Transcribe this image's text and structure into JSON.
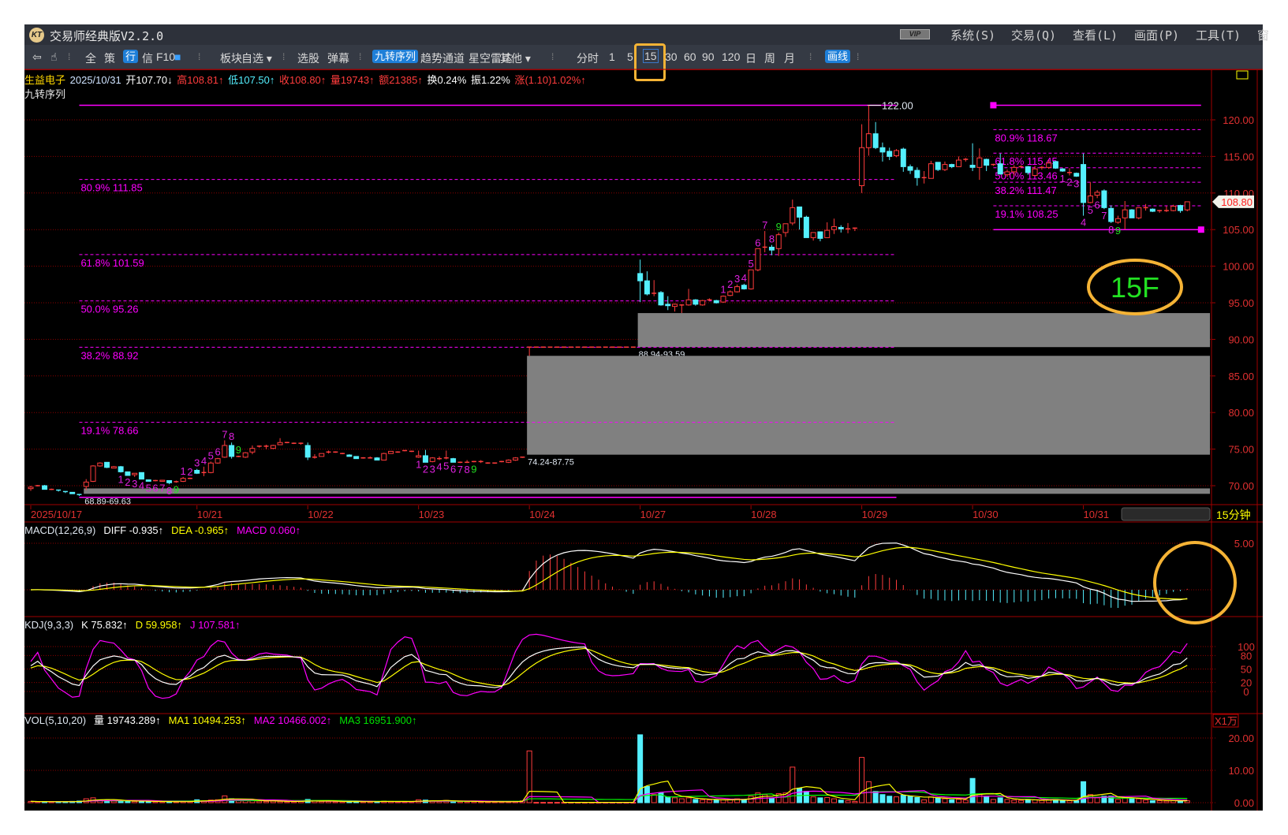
{
  "window": {
    "title": "交易师经典版V2.2.0",
    "logo_text": "KT",
    "vip": "VIP",
    "menu": [
      "系统(S)",
      "交易(Q)",
      "查看(L)",
      "画面(P)",
      "工具(T)",
      "窗"
    ]
  },
  "toolbar": {
    "items": [
      {
        "label": "⇦",
        "name": "back-icon"
      },
      {
        "label": "☝",
        "name": "hand-icon"
      },
      {
        "label": "⁞",
        "name": "separator"
      },
      {
        "label": "全",
        "name": "btn-all"
      },
      {
        "label": "策",
        "name": "btn-strategy"
      },
      {
        "label": "行",
        "name": "btn-quote",
        "style": "blue"
      },
      {
        "label": "信",
        "name": "btn-info"
      },
      {
        "label": "F10",
        "name": "btn-f10"
      },
      {
        "label": "■",
        "name": "color-icon"
      },
      {
        "label": "⁞",
        "name": "separator"
      },
      {
        "label": "板块",
        "name": "btn-sector"
      },
      {
        "label": "自选 ▾",
        "name": "btn-watchlist"
      },
      {
        "label": "⁞",
        "name": "separator"
      },
      {
        "label": "选股",
        "name": "btn-stock-picker"
      },
      {
        "label": "弹幕",
        "name": "btn-danmaku"
      },
      {
        "label": "⁞",
        "name": "separator"
      },
      {
        "label": "九转序列",
        "name": "btn-nine-turn",
        "style": "blue"
      },
      {
        "label": "趋势通道",
        "name": "btn-trend-channel"
      },
      {
        "label": "星空雷达",
        "name": "btn-star-radar"
      },
      {
        "label": "其他 ▾",
        "name": "btn-other"
      },
      {
        "label": "⁞",
        "name": "separator"
      },
      {
        "label": "分时",
        "name": "period-intraday"
      },
      {
        "label": "1",
        "name": "period-1"
      },
      {
        "label": "5",
        "name": "period-5"
      },
      {
        "label": "15",
        "name": "period-15",
        "style": "sel"
      },
      {
        "label": "30",
        "name": "period-30"
      },
      {
        "label": "60",
        "name": "period-60"
      },
      {
        "label": "90",
        "name": "period-90"
      },
      {
        "label": "120",
        "name": "period-120"
      },
      {
        "label": "日",
        "name": "period-day"
      },
      {
        "label": "周",
        "name": "period-week"
      },
      {
        "label": "月",
        "name": "period-month"
      },
      {
        "label": "⁞",
        "name": "separator"
      },
      {
        "label": "画线",
        "name": "btn-draw-line",
        "style": "blue"
      },
      {
        "label": "⁞",
        "name": "separator"
      }
    ]
  },
  "quote": {
    "name": "生益电子",
    "date": "2025/10/31",
    "open": "开107.70↓",
    "high": "高108.81↑",
    "low": "低107.50↑",
    "close": "收108.80↑",
    "volume": "量19743↑",
    "amount": "额21385↑",
    "turnover": "换0.24%",
    "amplitude": "振1.22%",
    "change": "涨(1.10)1.02%↑"
  },
  "indicator_title": "九转序列",
  "colors": {
    "up": "#ff3c3c",
    "down": "#54f0ff",
    "fib": "#ff00ff",
    "axis": "#e03030",
    "grid": "#8b0000",
    "annotation": "#f5b335",
    "green": "#22e022"
  },
  "price_axis": {
    "ticks": [
      "120.00",
      "115.00",
      "110.00",
      "105.00",
      "100.00",
      "95.00",
      "90.00",
      "85.00",
      "80.00",
      "75.00",
      "70.00"
    ],
    "last_price": "108.80"
  },
  "period_label": "15分钟",
  "dates": [
    {
      "i": 0,
      "label": "2025/10/17"
    },
    {
      "i": 24,
      "label": "10/21"
    },
    {
      "i": 40,
      "label": "10/22"
    },
    {
      "i": 56,
      "label": "10/23"
    },
    {
      "i": 72,
      "label": "10/24"
    },
    {
      "i": 88,
      "label": "10/27"
    },
    {
      "i": 104,
      "label": "10/28"
    },
    {
      "i": 120,
      "label": "10/29"
    },
    {
      "i": 136,
      "label": "10/30"
    },
    {
      "i": 152,
      "label": "10/31"
    }
  ],
  "candles": [
    [
      69.6,
      70.0,
      69.3,
      69.8
    ],
    [
      70.0,
      70.1,
      69.9,
      70.0
    ],
    [
      70.0,
      70.1,
      69.5,
      69.5
    ],
    [
      69.5,
      69.6,
      69.4,
      69.5
    ],
    [
      69.4,
      69.4,
      69.2,
      69.3
    ],
    [
      69.2,
      69.2,
      69.0,
      69.1
    ],
    [
      69.1,
      69.1,
      68.9,
      68.9
    ],
    [
      68.8,
      68.8,
      68.6,
      68.7
    ],
    [
      69.9,
      70.9,
      69.4,
      70.5
    ],
    [
      70.6,
      72.8,
      70.5,
      72.7
    ],
    [
      72.7,
      73.2,
      72.6,
      73.1
    ],
    [
      73.2,
      73.2,
      72.4,
      72.5
    ],
    [
      72.4,
      72.7,
      72.4,
      72.6
    ],
    [
      72.6,
      72.7,
      71.8,
      71.9
    ],
    [
      71.9,
      71.9,
      71.4,
      71.4
    ],
    [
      71.5,
      71.7,
      71.2,
      71.7
    ],
    [
      71.8,
      71.8,
      70.9,
      70.9
    ],
    [
      70.8,
      70.8,
      70.6,
      70.6
    ],
    [
      70.7,
      70.8,
      70.6,
      70.7
    ],
    [
      70.6,
      70.8,
      70.6,
      70.75
    ],
    [
      70.7,
      70.7,
      70.2,
      70.4
    ],
    [
      70.5,
      70.7,
      70.4,
      70.55
    ],
    [
      70.6,
      71.2,
      70.5,
      71.0
    ],
    [
      71.0,
      71.1,
      70.9,
      71.0
    ],
    [
      72.1,
      72.3,
      71.6,
      71.7
    ],
    [
      71.8,
      72.6,
      71.3,
      71.8
    ],
    [
      71.8,
      73.3,
      71.7,
      73.1
    ],
    [
      73.1,
      73.8,
      73.0,
      73.7
    ],
    [
      73.9,
      76.2,
      73.8,
      75.5
    ],
    [
      75.5,
      75.9,
      73.7,
      74.0
    ],
    [
      74.0,
      74.1,
      73.9,
      74.0
    ],
    [
      73.9,
      74.6,
      73.8,
      74.5
    ],
    [
      74.6,
      75.5,
      74.3,
      75.1
    ],
    [
      75.3,
      75.5,
      75.2,
      75.4
    ],
    [
      75.4,
      75.6,
      75.0,
      75.4
    ],
    [
      75.1,
      75.6,
      75.0,
      75.5
    ],
    [
      75.6,
      76.5,
      75.6,
      75.9
    ],
    [
      75.9,
      76.0,
      75.8,
      75.9
    ],
    [
      75.8,
      75.9,
      75.7,
      75.8
    ],
    [
      75.8,
      75.9,
      75.6,
      75.8
    ],
    [
      75.5,
      75.9,
      73.5,
      73.9
    ],
    [
      73.9,
      74.3,
      73.7,
      73.9
    ],
    [
      74.0,
      74.4,
      74.0,
      74.4
    ],
    [
      74.5,
      74.8,
      74.4,
      74.6
    ],
    [
      74.6,
      74.7,
      74.5,
      74.6
    ],
    [
      74.4,
      74.5,
      74.3,
      74.4
    ],
    [
      74.2,
      74.3,
      74.0,
      74.0
    ],
    [
      74.0,
      74.0,
      73.7,
      73.7
    ],
    [
      73.7,
      73.9,
      73.7,
      73.8
    ],
    [
      73.7,
      74.0,
      73.7,
      73.8
    ],
    [
      73.8,
      73.9,
      73.5,
      73.5
    ],
    [
      73.5,
      74.5,
      73.5,
      74.4
    ],
    [
      74.4,
      74.7,
      74.4,
      74.7
    ],
    [
      74.6,
      74.7,
      74.5,
      74.6
    ],
    [
      74.7,
      74.8,
      74.7,
      74.8
    ],
    [
      74.7,
      74.8,
      74.6,
      74.7
    ],
    [
      73.9,
      74.8,
      73.8,
      74.1
    ],
    [
      74.1,
      74.9,
      73.2,
      73.2
    ],
    [
      73.3,
      73.9,
      73.2,
      73.8
    ],
    [
      73.7,
      74.0,
      73.5,
      73.7
    ],
    [
      73.7,
      74.8,
      73.6,
      73.8
    ],
    [
      73.7,
      73.8,
      73.2,
      73.2
    ],
    [
      73.2,
      73.3,
      73.1,
      73.2
    ],
    [
      73.2,
      73.5,
      73.1,
      73.2
    ],
    [
      73.2,
      73.4,
      73.2,
      73.3
    ],
    [
      73.3,
      73.5,
      73.1,
      73.3
    ],
    [
      73.1,
      73.2,
      73.0,
      73.1
    ],
    [
      73.1,
      73.1,
      73.0,
      73.1
    ],
    [
      73.2,
      73.4,
      73.2,
      73.3
    ],
    [
      73.2,
      73.6,
      73.1,
      73.5
    ],
    [
      73.5,
      73.9,
      73.4,
      73.8
    ],
    [
      73.9,
      73.9,
      73.8,
      73.9
    ],
    [
      88.94,
      88.94,
      87.75,
      88.94
    ],
    [
      88.94,
      88.94,
      88.94,
      88.94
    ],
    [
      88.94,
      88.94,
      88.94,
      88.94
    ],
    [
      88.94,
      88.94,
      88.94,
      88.94
    ],
    [
      88.94,
      88.94,
      88.94,
      88.94
    ],
    [
      88.94,
      88.94,
      88.94,
      88.94
    ],
    [
      88.94,
      88.94,
      88.94,
      88.94
    ],
    [
      88.94,
      88.94,
      88.94,
      88.94
    ],
    [
      88.94,
      88.94,
      88.94,
      88.94
    ],
    [
      88.94,
      88.94,
      88.94,
      88.94
    ],
    [
      88.94,
      88.94,
      88.94,
      88.94
    ],
    [
      88.94,
      88.94,
      88.94,
      88.94
    ],
    [
      88.94,
      88.94,
      88.94,
      88.94
    ],
    [
      88.94,
      88.94,
      88.94,
      88.94
    ],
    [
      88.94,
      88.94,
      88.94,
      88.94
    ],
    [
      88.94,
      88.94,
      88.94,
      88.94
    ],
    [
      99.0,
      100.9,
      95.1,
      98.0
    ],
    [
      98.0,
      99.3,
      96.0,
      96.2
    ],
    [
      96.3,
      98.1,
      95.9,
      96.3
    ],
    [
      96.4,
      96.6,
      94.6,
      94.7
    ],
    [
      94.8,
      95.9,
      94.0,
      94.6
    ],
    [
      94.5,
      94.9,
      93.8,
      94.8
    ],
    [
      94.7,
      94.8,
      93.6,
      94.7
    ],
    [
      94.7,
      96.9,
      94.6,
      95.4
    ],
    [
      95.4,
      95.5,
      94.6,
      94.8
    ],
    [
      94.7,
      95.4,
      94.6,
      95.3
    ],
    [
      95.4,
      95.6,
      95.2,
      95.4
    ],
    [
      95.3,
      95.4,
      94.9,
      95.0
    ],
    [
      95.1,
      96.0,
      95.0,
      95.9
    ],
    [
      96.0,
      96.7,
      95.9,
      96.5
    ],
    [
      96.5,
      97.5,
      96.4,
      97.2
    ],
    [
      97.4,
      97.6,
      96.8,
      96.9
    ],
    [
      96.9,
      99.5,
      96.8,
      99.5
    ],
    [
      99.5,
      102.4,
      99.3,
      102.4
    ],
    [
      102.6,
      104.8,
      101.9,
      102.6
    ],
    [
      102.6,
      102.9,
      101.5,
      102.2
    ],
    [
      102.4,
      104.6,
      101.4,
      104.3
    ],
    [
      104.6,
      105.8,
      104.0,
      105.8
    ],
    [
      105.9,
      109.1,
      105.6,
      108.0
    ],
    [
      108.1,
      108.1,
      105.0,
      106.7
    ],
    [
      106.7,
      106.9,
      103.9,
      103.9
    ],
    [
      103.9,
      104.6,
      103.5,
      104.6
    ],
    [
      104.7,
      104.7,
      103.4,
      103.8
    ],
    [
      103.9,
      106.0,
      103.9,
      104.9
    ],
    [
      105.0,
      106.5,
      104.4,
      105.4
    ],
    [
      105.3,
      105.6,
      104.6,
      105.1
    ],
    [
      105.1,
      105.9,
      104.5,
      105.1
    ],
    [
      105.1,
      105.3,
      104.8,
      105.2
    ],
    [
      111.0,
      119.4,
      110.0,
      116.2
    ],
    [
      116.2,
      122.0,
      115.1,
      118.1
    ],
    [
      118.1,
      119.7,
      116.0,
      116.2
    ],
    [
      116.2,
      116.9,
      114.3,
      115.6
    ],
    [
      115.7,
      116.2,
      114.5,
      115.0
    ],
    [
      115.1,
      116.0,
      114.9,
      115.8
    ],
    [
      116.0,
      116.2,
      112.9,
      113.6
    ],
    [
      113.6,
      113.9,
      112.6,
      113.1
    ],
    [
      113.1,
      113.5,
      111.0,
      112.1
    ],
    [
      112.1,
      113.0,
      111.3,
      112.1
    ],
    [
      112.0,
      114.4,
      112.0,
      114.0
    ],
    [
      114.2,
      114.2,
      113.0,
      113.2
    ],
    [
      113.2,
      114.3,
      113.0,
      113.9
    ],
    [
      113.9,
      114.0,
      113.4,
      113.6
    ],
    [
      113.6,
      115.0,
      113.6,
      114.5
    ],
    [
      114.6,
      114.8,
      114.3,
      114.6
    ],
    [
      113.8,
      116.8,
      113.0,
      113.5
    ],
    [
      113.5,
      116.1,
      111.8,
      114.8
    ],
    [
      114.6,
      114.7,
      113.0,
      113.8
    ],
    [
      113.9,
      114.0,
      113.7,
      113.9
    ],
    [
      114.0,
      115.4,
      112.5,
      112.6
    ],
    [
      112.5,
      113.2,
      112.2,
      112.9
    ],
    [
      112.9,
      113.8,
      112.4,
      113.5
    ],
    [
      113.5,
      113.8,
      113.4,
      113.6
    ],
    [
      113.6,
      113.7,
      112.5,
      112.8
    ],
    [
      112.4,
      113.7,
      112.3,
      113.3
    ],
    [
      113.4,
      113.7,
      113.2,
      113.5
    ],
    [
      113.5,
      114.5,
      113.3,
      114.1
    ],
    [
      114.3,
      114.4,
      113.3,
      113.4
    ],
    [
      113.3,
      113.4,
      112.9,
      113.0
    ],
    [
      112.8,
      113.4,
      112.4,
      112.8
    ],
    [
      112.7,
      112.8,
      112.2,
      112.3
    ],
    [
      113.9,
      115.4,
      106.9,
      108.7
    ],
    [
      108.7,
      111.5,
      108.6,
      109.6
    ],
    [
      109.7,
      110.4,
      109.3,
      110.1
    ],
    [
      110.3,
      110.5,
      107.8,
      108.0
    ],
    [
      107.9,
      108.3,
      105.9,
      106.1
    ],
    [
      106.0,
      106.9,
      105.8,
      106.5
    ],
    [
      106.6,
      108.9,
      105.0,
      107.7
    ],
    [
      107.7,
      107.8,
      106.6,
      106.6
    ],
    [
      106.6,
      108.0,
      106.4,
      108.0
    ],
    [
      108.0,
      108.5,
      107.6,
      108.0
    ],
    [
      107.8,
      107.9,
      107.4,
      107.5
    ],
    [
      107.6,
      107.7,
      107.3,
      107.6
    ],
    [
      107.6,
      108.2,
      107.4,
      107.6
    ],
    [
      107.6,
      108.4,
      107.5,
      108.2
    ],
    [
      108.3,
      108.4,
      107.3,
      107.6
    ],
    [
      107.7,
      108.81,
      107.5,
      108.8
    ]
  ],
  "volumes": [
    0.4,
    0.3,
    0.3,
    0.3,
    0.3,
    0.3,
    0.4,
    0.5,
    1.2,
    1.5,
    0.8,
    0.7,
    0.5,
    0.6,
    0.5,
    0.4,
    0.5,
    0.3,
    0.3,
    0.3,
    0.3,
    0.3,
    0.4,
    0.4,
    0.9,
    0.6,
    0.8,
    0.9,
    2.1,
    1.2,
    0.6,
    0.7,
    0.8,
    0.5,
    0.4,
    0.5,
    0.4,
    0.3,
    0.3,
    0.4,
    1.0,
    0.5,
    0.4,
    0.4,
    0.3,
    0.3,
    0.3,
    0.4,
    0.3,
    0.3,
    0.3,
    0.5,
    0.4,
    0.3,
    0.3,
    0.3,
    0.9,
    0.8,
    0.6,
    0.4,
    0.7,
    0.5,
    0.3,
    0.3,
    0.3,
    0.3,
    0.3,
    0.3,
    0.3,
    0.3,
    0.4,
    0.6,
    16.0,
    0.1,
    0.1,
    0.1,
    0.1,
    0.1,
    0.1,
    0.1,
    0.1,
    0.1,
    0.1,
    0.1,
    0.1,
    0.1,
    0.1,
    0.1,
    21.0,
    5.0,
    2.5,
    3.0,
    1.8,
    1.5,
    1.2,
    1.5,
    1.0,
    0.9,
    0.8,
    0.8,
    0.9,
    1.0,
    1.2,
    1.0,
    2.0,
    3.0,
    2.5,
    1.5,
    2.8,
    3.0,
    11.0,
    4.5,
    3.5,
    1.8,
    1.5,
    1.6,
    1.2,
    0.8,
    0.6,
    0.4,
    14.0,
    6.5,
    3.5,
    2.5,
    2.0,
    1.8,
    2.3,
    2.0,
    1.6,
    0.9,
    1.8,
    1.5,
    1.2,
    0.9,
    1.0,
    0.8,
    7.5,
    2.5,
    1.8,
    1.0,
    1.5,
    1.0,
    0.8,
    0.7,
    1.0,
    0.9,
    0.7,
    0.8,
    1.0,
    0.6,
    0.6,
    0.6,
    6.5,
    2.5,
    1.5,
    2.0,
    2.0,
    1.0,
    1.5,
    1.2,
    1.2,
    0.8,
    0.6,
    0.6,
    0.5,
    0.6,
    0.6,
    0.6
  ],
  "fib_left": {
    "top": 122.0,
    "bottom": 68.41,
    "start": 7,
    "end": 125,
    "top_label": "122.00",
    "levels": [
      {
        "label": "80.9% 111.85",
        "price": 111.85
      },
      {
        "label": "61.8% 101.59",
        "price": 101.59
      },
      {
        "label": "50.0% 95.26",
        "price": 95.26
      },
      {
        "label": "38.2% 88.92",
        "price": 88.92
      },
      {
        "label": "19.1% 78.66",
        "price": 78.66
      }
    ]
  },
  "fib_right": {
    "top": 122.0,
    "bottom": 105.0,
    "start": 139,
    "end": 169,
    "levels": [
      {
        "label": "80.9% 118.67",
        "price": 118.67
      },
      {
        "label": "61.8% 115.45",
        "price": 115.45
      },
      {
        "label": "50.0% 113.46",
        "price": 113.46
      },
      {
        "label": "38.2% 111.47",
        "price": 111.47
      },
      {
        "label": "19.1% 108.25",
        "price": 108.25
      }
    ]
  },
  "gaps": [
    {
      "label": "88.94-93.59",
      "low": 88.94,
      "high": 93.59,
      "start": 88
    },
    {
      "label": "74.24-87.75",
      "low": 74.24,
      "high": 87.75,
      "start": 72
    },
    {
      "label": "68.89-69.63",
      "low": 68.89,
      "high": 69.63,
      "start": 8
    }
  ],
  "nine_turn": [
    {
      "start": 13,
      "dir": "down",
      "labels": [
        "1",
        "2",
        "3",
        "4",
        "5",
        "6",
        "7",
        "8",
        "9"
      ]
    },
    {
      "start": 22,
      "dir": "up",
      "labels": [
        "1",
        "2",
        "3",
        "4",
        "5",
        "6",
        "7",
        "8",
        "9"
      ]
    },
    {
      "start": 56,
      "dir": "down",
      "labels": [
        "1",
        "2",
        "3",
        "4",
        "5",
        "6",
        "7",
        "8",
        "9"
      ]
    },
    {
      "start": 100,
      "dir": "up",
      "labels": [
        "1",
        "2",
        "3",
        "4",
        "5",
        "6",
        "7",
        "8",
        "9"
      ]
    },
    {
      "start": 149,
      "dir": "down",
      "labels": [
        "1",
        "2",
        "3",
        "4",
        "5",
        "6",
        "7",
        "8",
        "9"
      ]
    }
  ],
  "annotation_label": "15F",
  "macd": {
    "name": "MACD(12,26,9)",
    "diff": "DIFF -0.935↑",
    "dea": "DEA -0.965↑",
    "macd": "MACD 0.060↑",
    "axis": [
      "5.00"
    ]
  },
  "kdj": {
    "name": "KDJ(9,3,3)",
    "k": "K 75.832↑",
    "d": "D 59.958↑",
    "j": "J 107.581↑",
    "axis": [
      "100",
      "80",
      "50",
      "20",
      "0"
    ]
  },
  "vol": {
    "name": "VOL(5,10,20)",
    "v": "量 19743.289↑",
    "ma1": "MA1 10494.253↑",
    "ma2": "MA2 10466.002↑",
    "ma3": "MA3 16951.900↑",
    "unit": "X1万",
    "axis": [
      "20.00",
      "10.00",
      "0.00"
    ]
  }
}
